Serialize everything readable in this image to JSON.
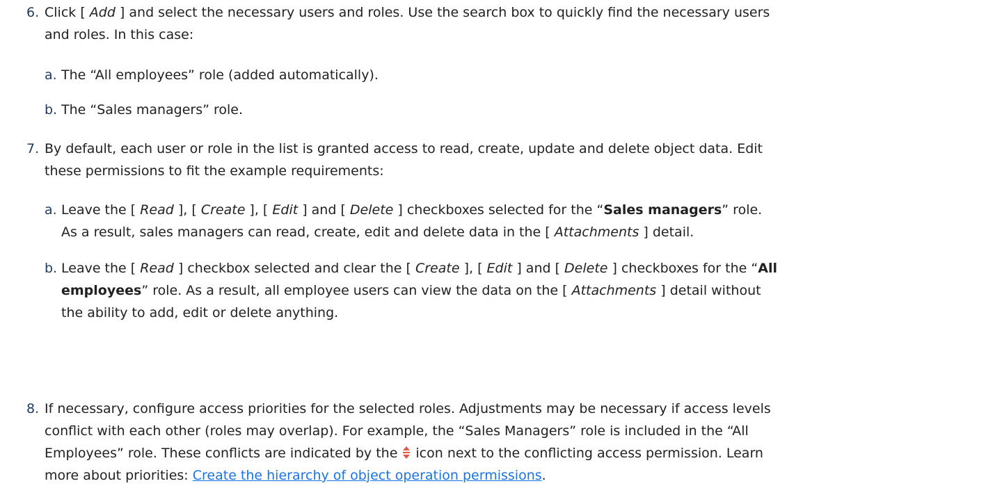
{
  "steps": [
    {
      "num": "6.",
      "t1": "Click [ ",
      "add": "Add",
      "t2": " ] and select the necessary users and roles. Use the search box to quickly find the necessary users",
      "t3": "and roles. In this case:",
      "subs": [
        {
          "letter": "a.",
          "text": "The “All employees” role (added automatically)."
        },
        {
          "letter": "b.",
          "text": "The “Sales managers” role."
        }
      ]
    },
    {
      "num": "7.",
      "line1": "By default, each user or role in the list is granted access to read, create, update and delete object data. Edit",
      "line2": "these permissions to fit the example requirements:",
      "suba": {
        "letter": "a.",
        "p1": "Leave the [ ",
        "read": "Read",
        "p2": " ], [ ",
        "create": "Create",
        "p3": " ], [ ",
        "edit": "Edit",
        "p4": " ] and [ ",
        "delete": "Delete",
        "p5": " ] checkboxes selected for the “",
        "role": "Sales managers",
        "p6": "” role.",
        "p7": "As a result, sales managers can read, create, edit and delete data in the [ ",
        "attach": "Attachments",
        "p8": " ] detail."
      },
      "subb": {
        "letter": "b.",
        "p1": "Leave the [ ",
        "read": "Read",
        "p2": " ] checkbox selected and clear the [ ",
        "create": "Create",
        "p3": " ], [ ",
        "edit": "Edit",
        "p4": " ] and [ ",
        "delete": "Delete",
        "p5": " ] checkboxes for the “",
        "role1": "All",
        "role2": "employees",
        "p6": "” role. As a result, all employee users can view the data on the [ ",
        "attach": "Attachments",
        "p7": " ] detail without",
        "p8": "the ability to add, edit or delete anything."
      }
    },
    {
      "num": "8.",
      "line1": "If necessary, configure access priorities for the selected roles. Adjustments may be necessary if access levels",
      "line2": "conflict with each other (roles may overlap). For example, the “Sales Managers” role is included in the “All",
      "line3a": "Employees” role. These conflicts are indicated by the",
      "line3b": "icon next to the conflicting access permission. Learn",
      "line4a": "more about priorities: ",
      "link": "Create the hierarchy of object operation permissions",
      "line4b": "."
    }
  ],
  "icons": {
    "conflict": "conflict-sort-arrows-icon",
    "conflict_color": "#e0584a"
  },
  "colors": {
    "number": "#1f3a5f",
    "link": "#1a73e8",
    "text": "#212121"
  }
}
